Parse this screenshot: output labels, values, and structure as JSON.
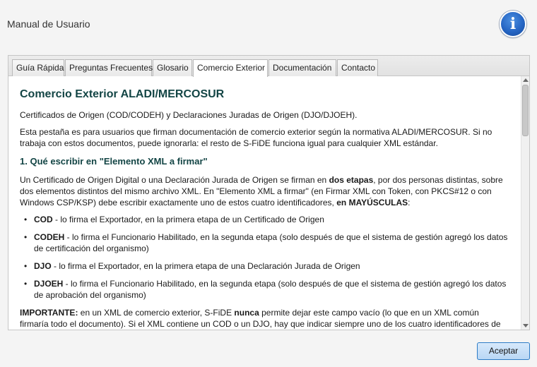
{
  "window": {
    "title": "Manual de Usuario",
    "info_icon": "i"
  },
  "tabs": [
    {
      "label": "Guía Rápida",
      "active": false
    },
    {
      "label": "Preguntas Frecuentes",
      "active": false
    },
    {
      "label": "Glosario",
      "active": false
    },
    {
      "label": "Comercio Exterior",
      "active": true
    },
    {
      "label": "Documentación",
      "active": false
    },
    {
      "label": "Contacto",
      "active": false
    }
  ],
  "content": {
    "title": "Comercio Exterior ALADI/MERCOSUR",
    "subtitle": "Certificados de Origen (COD/CODEH) y Declaraciones Juradas de Origen (DJO/DJOEH).",
    "intro": "Esta pestaña es para usuarios que firman documentación de comercio exterior según la normativa ALADI/MERCOSUR. Si no trabaja con estos documentos, puede ignorarla: el resto de S-FiDE funciona igual para cualquier XML estándar.",
    "section1_title": "1. Qué escribir en \"Elemento XML a firmar\"",
    "section1_p_a": "Un Certificado de Origen Digital o una Declaración Jurada de Origen se firman en ",
    "section1_p_bold1": "dos etapas",
    "section1_p_b": ", por dos personas distintas, sobre dos elementos distintos del mismo archivo XML. En \"Elemento XML a firmar\" (en Firmar XML con Token, con PKCS#12 o con Windows CSP/KSP) debe escribir exactamente uno de estos cuatro identificadores, ",
    "section1_p_bold2": "en MAYÚSCULAS",
    "section1_p_c": ":",
    "items": [
      {
        "code": "COD",
        "text": " - lo firma el Exportador, en la primera etapa de un Certificado de Origen"
      },
      {
        "code": "CODEH",
        "text": " - lo firma el Funcionario Habilitado, en la segunda etapa (solo después de que el sistema de gestión agregó los datos de certificación del organismo)"
      },
      {
        "code": "DJO",
        "text": " - lo firma el Exportador, en la primera etapa de una Declaración Jurada de Origen"
      },
      {
        "code": "DJOEH",
        "text": " - lo firma el Funcionario Habilitado, en la segunda etapa (solo después de que el sistema de gestión agregó los datos de aprobación del organismo)"
      }
    ],
    "important_label": "IMPORTANTE:",
    "important_a": " en un XML de comercio exterior, S-FiDE ",
    "important_bold": "nunca",
    "important_b": " permite dejar este campo vacío (lo que en un XML común firmaría todo el documento). Si el XML contiene un COD o un DJO, hay que indicar siempre uno de los cuatro identificadores de arriba."
  },
  "buttons": {
    "accept": "Aceptar"
  }
}
